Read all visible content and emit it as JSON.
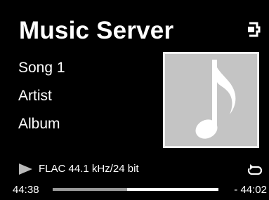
{
  "header": {
    "title": "Music Server",
    "input_icon": "input-source-icon"
  },
  "track": {
    "song": "Song 1",
    "artist": "Artist",
    "album": "Album",
    "artwork_icon": "music-note-icon"
  },
  "status": {
    "play_icon": "play-icon",
    "format": "FLAC 44.1 kHz/24 bit",
    "repeat_icon": "repeat-icon"
  },
  "progress": {
    "elapsed": "44:38",
    "remaining": "- 44:02",
    "fraction": 0.45
  },
  "colors": {
    "background": "#000000",
    "text": "#ffffff",
    "artwork_bg": "#c4c4c4",
    "progress_played": "#9a9a9a",
    "progress_track": "#ffffff"
  }
}
